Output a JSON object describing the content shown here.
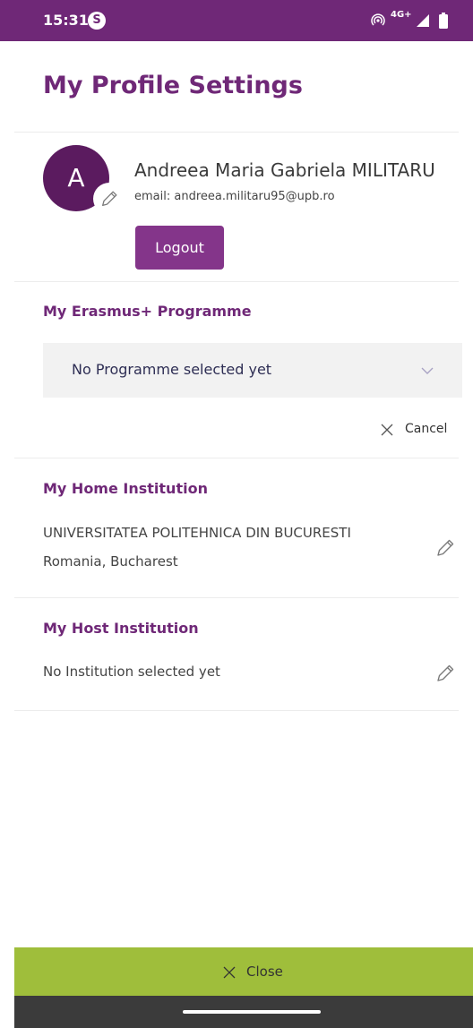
{
  "status_bar": {
    "time": "15:31",
    "app_icon_letter": "S",
    "network": "4G+",
    "background_color": "#6f2877"
  },
  "page": {
    "title": "My Profile Settings"
  },
  "profile": {
    "avatar_initial": "A",
    "name": "Andreea Maria Gabriela MILITARU",
    "email": "email: andreea.militaru95@upb.ro",
    "logout_label": "Logout",
    "edit_avatar_icon": "pencil-icon"
  },
  "programme": {
    "heading": "My Erasmus+ Programme",
    "selected_value": "No Programme selected yet",
    "dropdown_icon": "chevron-down-icon",
    "cancel_label": "Cancel"
  },
  "home_institution": {
    "heading": "My Home Institution",
    "name": "UNIVERSITATEA POLITEHNICA DIN BUCURESTI",
    "location": "Romania, Bucharest",
    "edit_icon": "pencil-icon"
  },
  "host_institution": {
    "heading": "My Host Institution",
    "value": "No Institution selected yet",
    "edit_icon": "pencil-icon"
  },
  "footer": {
    "close_label": "Close",
    "close_bar_color": "#9fbe3b"
  },
  "colors": {
    "brand_purple": "#6f2877",
    "button_purple": "#84358a",
    "avatar_purple": "#5b1b5f",
    "accent_green": "#9fbe3b"
  }
}
